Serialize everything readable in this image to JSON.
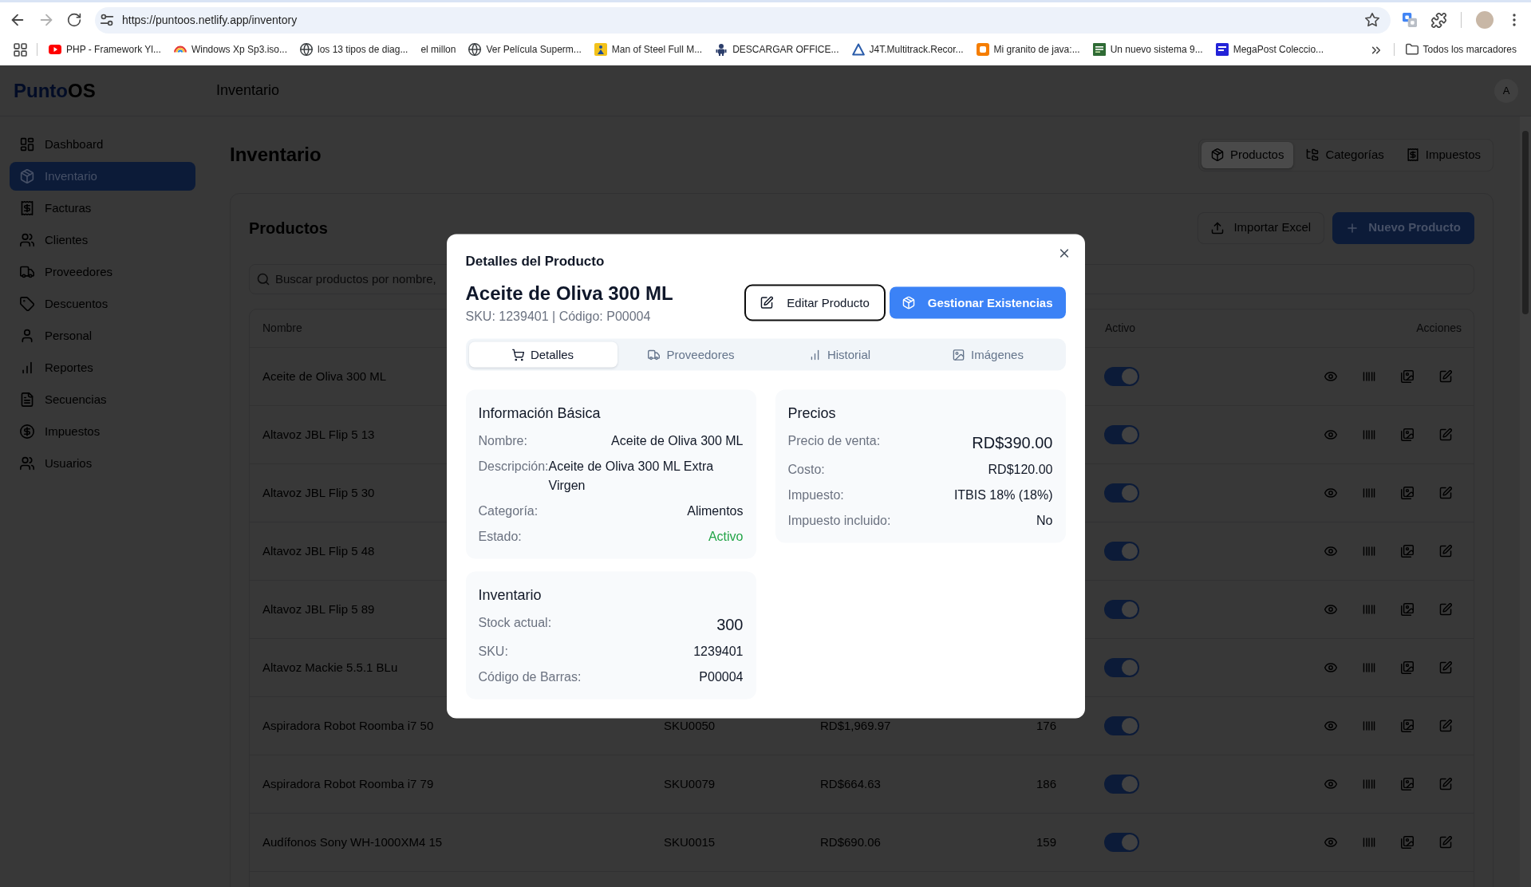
{
  "browser": {
    "url": "https://puntoos.netlify.app/inventory",
    "bookmarks": [
      {
        "label": "PHP - Framework Yl..."
      },
      {
        "label": "Windows Xp Sp3.iso..."
      },
      {
        "label": "los 13 tipos de diag..."
      },
      {
        "label": "el millon"
      },
      {
        "label": "Ver Película Superm..."
      },
      {
        "label": "Man of Steel Full M..."
      },
      {
        "label": "DESCARGAR OFFICE..."
      },
      {
        "label": "J4T.Multitrack.Recor..."
      },
      {
        "label": "Mi granito de java:..."
      },
      {
        "label": "Un nuevo sistema 9..."
      },
      {
        "label": "MegaPost Coleccio..."
      }
    ],
    "all_bookmarks": "Todos los marcadores"
  },
  "app": {
    "logo": {
      "accent": "Punto",
      "rest": "OS"
    },
    "header": {
      "title": "Inventario",
      "avatar": "A"
    }
  },
  "sidebar": {
    "items": [
      {
        "label": "Dashboard",
        "selected": false
      },
      {
        "label": "Inventario",
        "selected": true
      },
      {
        "label": "Facturas",
        "selected": false
      },
      {
        "label": "Clientes",
        "selected": false
      },
      {
        "label": "Proveedores",
        "selected": false
      },
      {
        "label": "Descuentos",
        "selected": false
      },
      {
        "label": "Personal",
        "selected": false
      },
      {
        "label": "Reportes",
        "selected": false
      },
      {
        "label": "Secuencias",
        "selected": false
      },
      {
        "label": "Impuestos",
        "selected": false
      },
      {
        "label": "Usuarios",
        "selected": false
      }
    ]
  },
  "page": {
    "title": "Inventario",
    "view_tabs": [
      {
        "label": "Productos",
        "selected": true
      },
      {
        "label": "Categorías",
        "selected": false
      },
      {
        "label": "Impuestos",
        "selected": false
      }
    ]
  },
  "products": {
    "title": "Productos",
    "buttons": [
      {
        "label": "Importar Excel",
        "kind": "outline"
      },
      {
        "label": "Nuevo Producto",
        "kind": "primary"
      }
    ],
    "search": {
      "placeholder": "Buscar productos por nombre,"
    },
    "table": {
      "columns": {
        "name": "Nombre",
        "active": "Activo",
        "actions": "Acciones"
      },
      "rows": [
        {
          "name": "Aceite de Oliva 300 ML",
          "active": true
        },
        {
          "name": "Altavoz JBL Flip 5 13",
          "active": true
        },
        {
          "name": "Altavoz JBL Flip 5 30",
          "active": true
        },
        {
          "name": "Altavoz JBL Flip 5 48",
          "active": true
        },
        {
          "name": "Altavoz JBL Flip 5 89",
          "active": true
        },
        {
          "name": "Altavoz Mackie 5.5.1 BLu",
          "active": true
        },
        {
          "name": "Aspiradora Robot Roomba i7 50",
          "sku": "SKU0050",
          "price": "RD$1,969.97",
          "stock": "176",
          "active": true
        },
        {
          "name": "Aspiradora Robot Roomba i7 79",
          "sku": "SKU0079",
          "price": "RD$664.63",
          "stock": "186",
          "active": true
        },
        {
          "name": "Audífonos Sony WH-1000XM4 15",
          "sku": "SKU0015",
          "price": "RD$690.06",
          "stock": "159",
          "active": true
        }
      ]
    }
  },
  "modal": {
    "title": "Detalles del Producto",
    "product_name": "Aceite de Oliva 300 ML",
    "subtitle": "SKU: 1239401 | Código: P00004",
    "buttons": [
      {
        "label": "Editar Producto",
        "kind": "outline"
      },
      {
        "label": "Gestionar Existencias",
        "kind": "primary"
      }
    ],
    "tabs": [
      {
        "label": "Detalles",
        "selected": true
      },
      {
        "label": "Proveedores",
        "selected": false
      },
      {
        "label": "Historial",
        "selected": false
      },
      {
        "label": "Imágenes",
        "selected": false
      }
    ],
    "sections": [
      {
        "title": "Información Básica",
        "rows": [
          {
            "label": "Nombre:",
            "value": "Aceite de Oliva 300 ML",
            "kind": "plain"
          },
          {
            "label": "Descripción:",
            "value": "Aceite de Oliva 300 ML Extra Virgen",
            "kind": "plain"
          },
          {
            "label": "Categoría:",
            "value": "Alimentos",
            "kind": "plain"
          },
          {
            "label": "Estado:",
            "value": "Activo",
            "kind": "status"
          }
        ]
      },
      {
        "title": "Precios",
        "rows": [
          {
            "label": "Precio de venta:",
            "value": "RD$390.00",
            "kind": "large"
          },
          {
            "label": "Costo:",
            "value": "RD$120.00",
            "kind": "plain"
          },
          {
            "label": "Impuesto:",
            "value": "ITBIS 18% (18%)",
            "kind": "plain"
          },
          {
            "label": "Impuesto incluido:",
            "value": "No",
            "kind": "plain"
          }
        ]
      },
      {
        "title": "Inventario",
        "rows": [
          {
            "label": "Stock actual:",
            "value": "300",
            "kind": "large"
          },
          {
            "label": "SKU:",
            "value": "1239401",
            "kind": "plain"
          },
          {
            "label": "Código de Barras:",
            "value": "P00004",
            "kind": "plain"
          }
        ]
      }
    ]
  }
}
